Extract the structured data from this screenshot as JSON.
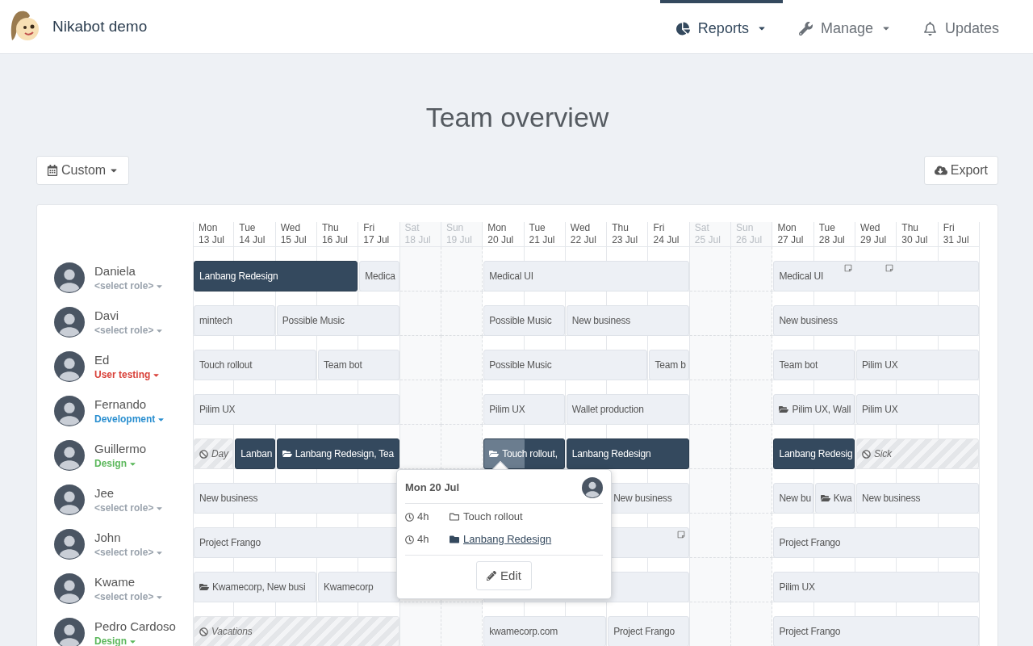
{
  "app": {
    "name": "Nikabot demo"
  },
  "nav": [
    {
      "label": "Reports",
      "dropdown": true,
      "selected": true
    },
    {
      "label": "Manage",
      "dropdown": true,
      "selected": false
    },
    {
      "label": "Updates",
      "dropdown": false,
      "selected": false
    }
  ],
  "title": "Team overview",
  "range_button": "Custom",
  "export_button": "Export",
  "days": [
    {
      "weekday": "Mon",
      "date": "13 Jul",
      "weekend": false
    },
    {
      "weekday": "Tue",
      "date": "14 Jul",
      "weekend": false
    },
    {
      "weekday": "Wed",
      "date": "15 Jul",
      "weekend": false
    },
    {
      "weekday": "Thu",
      "date": "16 Jul",
      "weekend": false
    },
    {
      "weekday": "Fri",
      "date": "17 Jul",
      "weekend": false
    },
    {
      "weekday": "Sat",
      "date": "18 Jul",
      "weekend": true
    },
    {
      "weekday": "Sun",
      "date": "19 Jul",
      "weekend": true
    },
    {
      "weekday": "Mon",
      "date": "20 Jul",
      "weekend": false
    },
    {
      "weekday": "Tue",
      "date": "21 Jul",
      "weekend": false
    },
    {
      "weekday": "Wed",
      "date": "22 Jul",
      "weekend": false
    },
    {
      "weekday": "Thu",
      "date": "23 Jul",
      "weekend": false
    },
    {
      "weekday": "Fri",
      "date": "24 Jul",
      "weekend": false
    },
    {
      "weekday": "Sat",
      "date": "25 Jul",
      "weekend": true
    },
    {
      "weekday": "Sun",
      "date": "26 Jul",
      "weekend": true
    },
    {
      "weekday": "Mon",
      "date": "27 Jul",
      "weekend": false
    },
    {
      "weekday": "Tue",
      "date": "28 Jul",
      "weekend": false
    },
    {
      "weekday": "Wed",
      "date": "29 Jul",
      "weekend": false
    },
    {
      "weekday": "Thu",
      "date": "30 Jul",
      "weekend": false
    },
    {
      "weekday": "Fri",
      "date": "31 Jul",
      "weekend": false
    }
  ],
  "people": [
    {
      "name": "Daniela",
      "role": {
        "label": "<select role>",
        "color": "#9aa3ad"
      },
      "days": [
        {
          "kind": "active",
          "label": "Lanbang Redesign"
        },
        {
          "kind": "continued"
        },
        {
          "kind": "continued"
        },
        {
          "kind": "continued"
        },
        {
          "kind": "project",
          "label": "Medica"
        },
        {
          "kind": "free"
        },
        {
          "kind": "free"
        },
        {
          "kind": "project",
          "label": "Medical UI"
        },
        {
          "kind": "continued"
        },
        {
          "kind": "continued"
        },
        {
          "kind": "continued"
        },
        {
          "kind": "continued"
        },
        {
          "kind": "free"
        },
        {
          "kind": "free"
        },
        {
          "kind": "project",
          "label": "Medical UI"
        },
        {
          "kind": "continued",
          "note": true
        },
        {
          "kind": "continued",
          "note": true
        },
        {
          "kind": "continued"
        },
        {
          "kind": "continued"
        }
      ]
    },
    {
      "name": "Davi",
      "role": {
        "label": "<select role>",
        "color": "#9aa3ad"
      },
      "days": [
        {
          "kind": "project",
          "label": "mintech"
        },
        {
          "kind": "continued"
        },
        {
          "kind": "project",
          "label": "Possible Music"
        },
        {
          "kind": "continued"
        },
        {
          "kind": "continued"
        },
        {
          "kind": "free"
        },
        {
          "kind": "free"
        },
        {
          "kind": "project",
          "label": "Possible Music"
        },
        {
          "kind": "continued"
        },
        {
          "kind": "project",
          "label": "New business"
        },
        {
          "kind": "continued"
        },
        {
          "kind": "continued"
        },
        {
          "kind": "free"
        },
        {
          "kind": "free"
        },
        {
          "kind": "project",
          "label": "New business"
        },
        {
          "kind": "continued"
        },
        {
          "kind": "continued"
        },
        {
          "kind": "continued"
        },
        {
          "kind": "continued"
        }
      ]
    },
    {
      "name": "Ed",
      "role": {
        "label": "User testing",
        "color": "#d9423a"
      },
      "days": [
        {
          "kind": "project",
          "label": "Touch rollout"
        },
        {
          "kind": "continued"
        },
        {
          "kind": "continued"
        },
        {
          "kind": "project",
          "label": "Team bot"
        },
        {
          "kind": "continued"
        },
        {
          "kind": "free"
        },
        {
          "kind": "free"
        },
        {
          "kind": "project",
          "label": "Possible Music"
        },
        {
          "kind": "continued"
        },
        {
          "kind": "continued"
        },
        {
          "kind": "continued"
        },
        {
          "kind": "project",
          "label": "Team b"
        },
        {
          "kind": "free"
        },
        {
          "kind": "free"
        },
        {
          "kind": "project",
          "label": "Team bot"
        },
        {
          "kind": "continued"
        },
        {
          "kind": "project",
          "label": "Pilim UX"
        },
        {
          "kind": "continued"
        },
        {
          "kind": "continued"
        }
      ]
    },
    {
      "name": "Fernando",
      "role": {
        "label": "Development",
        "color": "#2a8fd0"
      },
      "days": [
        {
          "kind": "project",
          "label": "Pilim UX"
        },
        {
          "kind": "continued"
        },
        {
          "kind": "continued"
        },
        {
          "kind": "continued"
        },
        {
          "kind": "continued"
        },
        {
          "kind": "free"
        },
        {
          "kind": "free"
        },
        {
          "kind": "project",
          "label": "Pilim UX"
        },
        {
          "kind": "continued"
        },
        {
          "kind": "project",
          "label": "Wallet production"
        },
        {
          "kind": "continued"
        },
        {
          "kind": "continued"
        },
        {
          "kind": "free"
        },
        {
          "kind": "free"
        },
        {
          "kind": "project",
          "label": "Pilim UX, Wall",
          "folder": true
        },
        {
          "kind": "continued"
        },
        {
          "kind": "project",
          "label": "Pilim UX"
        },
        {
          "kind": "continued"
        },
        {
          "kind": "continued"
        }
      ]
    },
    {
      "name": "Guillermo",
      "role": {
        "label": "Design",
        "color": "#5cb85c"
      },
      "days": [
        {
          "kind": "absence",
          "label": "Day"
        },
        {
          "kind": "active",
          "label": "Lanban"
        },
        {
          "kind": "active",
          "label": "Lanbang Redesign, Tea",
          "folder": true
        },
        {
          "kind": "continued"
        },
        {
          "kind": "continued"
        },
        {
          "kind": "free"
        },
        {
          "kind": "free"
        },
        {
          "kind": "active",
          "label": "Touch rollout,",
          "folder": true,
          "selected": true
        },
        {
          "kind": "continued"
        },
        {
          "kind": "active",
          "label": "Lanbang Redesign"
        },
        {
          "kind": "continued"
        },
        {
          "kind": "continued"
        },
        {
          "kind": "free"
        },
        {
          "kind": "free"
        },
        {
          "kind": "active",
          "label": "Lanbang Redesig"
        },
        {
          "kind": "continued"
        },
        {
          "kind": "absence",
          "label": "Sick"
        },
        {
          "kind": "continued"
        },
        {
          "kind": "continued"
        }
      ]
    },
    {
      "name": "Jee",
      "role": {
        "label": "<select role>",
        "color": "#9aa3ad"
      },
      "days": [
        {
          "kind": "project",
          "label": "New business"
        },
        {
          "kind": "continued"
        },
        {
          "kind": "continued"
        },
        {
          "kind": "continued"
        },
        {
          "kind": "continued"
        },
        {
          "kind": "free"
        },
        {
          "kind": "free"
        },
        {
          "kind": "free"
        },
        {
          "kind": "free"
        },
        {
          "kind": "free"
        },
        {
          "kind": "project",
          "label": "New business"
        },
        {
          "kind": "continued"
        },
        {
          "kind": "free"
        },
        {
          "kind": "free"
        },
        {
          "kind": "project",
          "label": "New bu"
        },
        {
          "kind": "project",
          "label": "Kwa",
          "folder": true
        },
        {
          "kind": "project",
          "label": "New business"
        },
        {
          "kind": "continued"
        },
        {
          "kind": "continued"
        }
      ]
    },
    {
      "name": "John",
      "role": {
        "label": "<select role>",
        "color": "#9aa3ad"
      },
      "days": [
        {
          "kind": "project",
          "label": "Project Frango"
        },
        {
          "kind": "continued"
        },
        {
          "kind": "continued"
        },
        {
          "kind": "continued"
        },
        {
          "kind": "continued"
        },
        {
          "kind": "free"
        },
        {
          "kind": "free"
        },
        {
          "kind": "project"
        },
        {
          "kind": "continued"
        },
        {
          "kind": "continued"
        },
        {
          "kind": "continued"
        },
        {
          "kind": "continued",
          "note": true
        },
        {
          "kind": "free"
        },
        {
          "kind": "free"
        },
        {
          "kind": "project",
          "label": "Project Frango"
        },
        {
          "kind": "continued"
        },
        {
          "kind": "continued"
        },
        {
          "kind": "continued"
        },
        {
          "kind": "continued"
        }
      ]
    },
    {
      "name": "Kwame",
      "role": {
        "label": "<select role>",
        "color": "#9aa3ad"
      },
      "days": [
        {
          "kind": "project",
          "label": "Kwamecorp, New busi",
          "folder": true
        },
        {
          "kind": "continued"
        },
        {
          "kind": "continued"
        },
        {
          "kind": "project",
          "label": "Kwamecorp"
        },
        {
          "kind": "continued"
        },
        {
          "kind": "free"
        },
        {
          "kind": "free"
        },
        {
          "kind": "project"
        },
        {
          "kind": "continued"
        },
        {
          "kind": "continued"
        },
        {
          "kind": "continued"
        },
        {
          "kind": "continued"
        },
        {
          "kind": "free"
        },
        {
          "kind": "free"
        },
        {
          "kind": "project",
          "label": "Pilim UX"
        },
        {
          "kind": "continued"
        },
        {
          "kind": "continued"
        },
        {
          "kind": "continued"
        },
        {
          "kind": "continued"
        }
      ]
    },
    {
      "name": "Pedro Cardoso",
      "role": {
        "label": "Design",
        "color": "#5cb85c"
      },
      "days": [
        {
          "kind": "absence",
          "label": "Vacations"
        },
        {
          "kind": "continued"
        },
        {
          "kind": "continued"
        },
        {
          "kind": "continued"
        },
        {
          "kind": "continued"
        },
        {
          "kind": "free"
        },
        {
          "kind": "free"
        },
        {
          "kind": "project",
          "label": "kwamecorp.com"
        },
        {
          "kind": "continued"
        },
        {
          "kind": "continued"
        },
        {
          "kind": "project",
          "label": "Project Frango"
        },
        {
          "kind": "continued"
        },
        {
          "kind": "free"
        },
        {
          "kind": "free"
        },
        {
          "kind": "project",
          "label": "Project Frango"
        },
        {
          "kind": "continued"
        },
        {
          "kind": "continued"
        },
        {
          "kind": "continued"
        },
        {
          "kind": "continued"
        }
      ]
    }
  ],
  "popover": {
    "date": "Mon 20 Jul",
    "entries": [
      {
        "hours": "4h",
        "project": "Touch rollout",
        "linked": false
      },
      {
        "hours": "4h",
        "project": "Lanbang Redesign",
        "linked": true
      }
    ],
    "button": "Edit"
  }
}
